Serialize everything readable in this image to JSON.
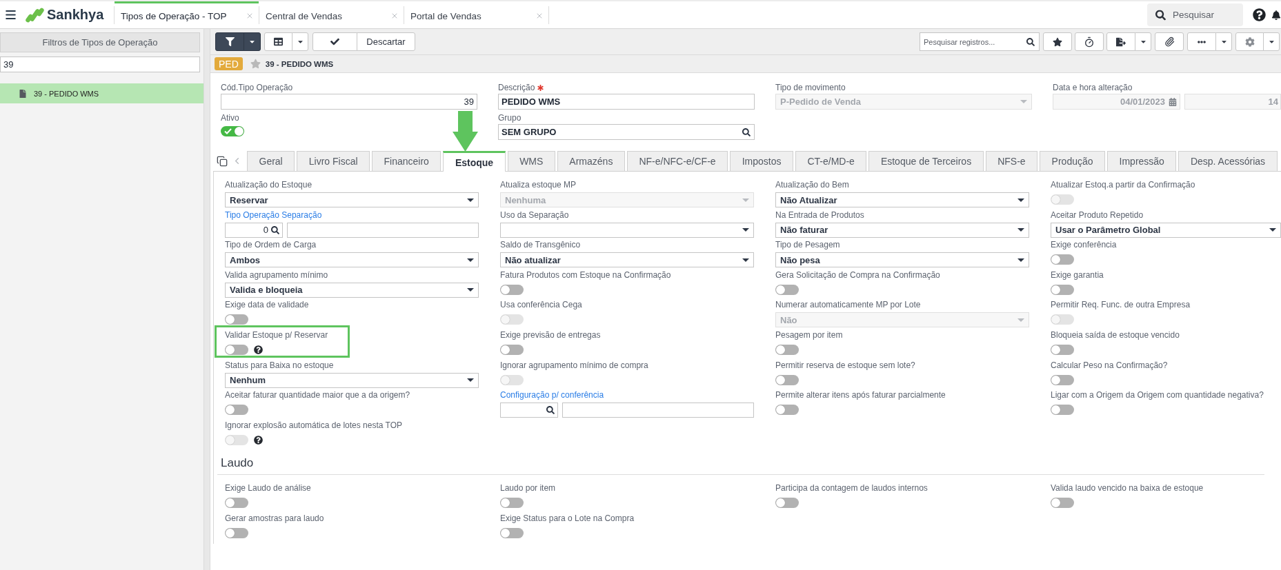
{
  "top_bar": {
    "logo": "Sankhya",
    "tabs": [
      {
        "label": "Tipos de Operação - TOP",
        "selected": true
      },
      {
        "label": "Central de Vendas",
        "selected": false
      },
      {
        "label": "Portal de Vendas",
        "selected": false
      }
    ],
    "search": {
      "placeholder": "Pesquisar"
    }
  },
  "sidebar": {
    "title": "Filtros de Tipos de Operação",
    "filter": {
      "value": "39"
    },
    "items": [
      {
        "label": "39 - PEDIDO WMS",
        "selected": true
      }
    ]
  },
  "toolbar": {
    "discard": "Descartar",
    "search": {
      "placeholder": "Pesquisar registros..."
    }
  },
  "record": {
    "badge": "PED",
    "favorite": false,
    "title": "39 - PEDIDO WMS"
  },
  "header": {
    "rows": [
      [
        {
          "label": "Cód.Tipo Operação",
          "kind": "number",
          "value": "39",
          "required": false
        },
        {
          "label": "Descrição",
          "kind": "text",
          "value": "PEDIDO WMS",
          "required": true
        },
        {
          "label": "Tipo de movimento",
          "kind": "select",
          "value": "P-Pedido de Venda",
          "disabled": true,
          "required": false
        },
        {
          "label": "Data e hora alteração",
          "kind": "datetime",
          "date": "04/01/2023",
          "time": "14",
          "disabled": true,
          "required": false
        }
      ],
      [
        {
          "label": "Ativo",
          "kind": "toggle",
          "on": true,
          "disabled": false,
          "required": false
        },
        {
          "label": "Grupo",
          "kind": "search",
          "value": "SEM GRUPO",
          "required": false
        }
      ]
    ]
  },
  "tabs": [
    {
      "label": "Geral",
      "selected": false,
      "pointer_arrow": false
    },
    {
      "label": "Livro Fiscal",
      "selected": false,
      "pointer_arrow": false
    },
    {
      "label": "Financeiro",
      "selected": false,
      "pointer_arrow": false
    },
    {
      "label": "Estoque",
      "selected": true,
      "pointer_arrow": true
    },
    {
      "label": "WMS",
      "selected": false,
      "pointer_arrow": false
    },
    {
      "label": "Armazéns",
      "selected": false,
      "pointer_arrow": false
    },
    {
      "label": "NF-e/NFC-e/CF-e",
      "selected": false,
      "pointer_arrow": false
    },
    {
      "label": "Impostos",
      "selected": false,
      "pointer_arrow": false
    },
    {
      "label": "CT-e/MD-e",
      "selected": false,
      "pointer_arrow": false
    },
    {
      "label": "Estoque de Terceiros",
      "selected": false,
      "pointer_arrow": false
    },
    {
      "label": "NFS-e",
      "selected": false,
      "pointer_arrow": false
    },
    {
      "label": "Produção",
      "selected": false,
      "pointer_arrow": false
    },
    {
      "label": "Impressão",
      "selected": false,
      "pointer_arrow": false
    },
    {
      "label": "Desp. Acessórias",
      "selected": false,
      "pointer_arrow": false
    }
  ],
  "tab_content": {
    "columns": [
      {
        "fields": [
          {
            "label": "Atualização do Estoque",
            "kind": "select",
            "value": "Reservar",
            "disabled": false,
            "highlighted": false
          },
          {
            "label": "Tipo Operação Separação",
            "kind": "lookup",
            "code": "0",
            "highlighted": false
          },
          {
            "label": "Tipo de Ordem de Carga",
            "kind": "select",
            "value": "Ambos",
            "disabled": false,
            "highlighted": false
          },
          {
            "label": "Valida agrupamento mínimo",
            "kind": "select",
            "value": "Valida e bloqueia",
            "disabled": false,
            "highlighted": false
          },
          {
            "label": "Exige data de validade",
            "kind": "toggle",
            "on": false,
            "disabled": false,
            "help": false,
            "highlighted": false
          },
          {
            "label": "Validar Estoque p/ Reservar",
            "kind": "toggle",
            "on": false,
            "disabled": false,
            "help": true,
            "highlighted": true
          },
          {
            "label": "Status para Baixa no estoque",
            "kind": "select",
            "value": "Nenhum",
            "disabled": false,
            "highlighted": false
          },
          {
            "label": "Aceitar faturar quantidade maior que a da origem?",
            "kind": "toggle",
            "on": false,
            "disabled": false,
            "help": false,
            "highlighted": false
          },
          {
            "label": "Ignorar explosão automática de lotes nesta TOP",
            "kind": "toggle",
            "on": false,
            "disabled": true,
            "help": true,
            "highlighted": false
          }
        ]
      },
      {
        "fields": [
          {
            "label": "Atualiza estoque MP",
            "kind": "select",
            "value": "Nenhuma",
            "disabled": true,
            "highlighted": false
          },
          {
            "label": "Uso da Separação",
            "kind": "select",
            "disabled": false,
            "highlighted": false
          },
          {
            "label": "Saldo de Transgênico",
            "kind": "select",
            "value": "Não atualizar",
            "disabled": false,
            "highlighted": false
          },
          {
            "label": "Fatura Produtos com Estoque na Confirmação",
            "kind": "toggle",
            "on": false,
            "disabled": false,
            "help": false,
            "highlighted": false
          },
          {
            "label": "Usa conferência Cega",
            "kind": "toggle",
            "on": false,
            "disabled": true,
            "help": false,
            "highlighted": false
          },
          {
            "label": "Exige previsão de entregas",
            "kind": "toggle",
            "on": false,
            "disabled": false,
            "help": false,
            "highlighted": false
          },
          {
            "label": "Ignorar agrupamento mínimo de compra",
            "kind": "toggle",
            "on": false,
            "disabled": true,
            "help": false,
            "highlighted": false
          },
          {
            "label": "Configuração p/ conferência",
            "kind": "lookup",
            "highlighted": false
          }
        ]
      },
      {
        "fields": [
          {
            "label": "Atualização do Bem",
            "kind": "select",
            "value": "Não Atualizar",
            "disabled": false,
            "highlighted": false
          },
          {
            "label": "Na Entrada de Produtos",
            "kind": "select",
            "value": "Não faturar",
            "disabled": false,
            "highlighted": false
          },
          {
            "label": "Tipo de Pesagem",
            "kind": "select",
            "value": "Não pesa",
            "disabled": false,
            "highlighted": false
          },
          {
            "label": "Gera Solicitação de Compra na Confirmação",
            "kind": "toggle",
            "on": false,
            "disabled": false,
            "help": false,
            "highlighted": false
          },
          {
            "label": "Numerar automaticamente MP por Lote",
            "kind": "select",
            "value": "Não",
            "disabled": true,
            "highlighted": false
          },
          {
            "label": "Pesagem por item",
            "kind": "toggle",
            "on": false,
            "disabled": false,
            "help": false,
            "highlighted": false
          },
          {
            "label": "Permitir reserva de estoque sem lote?",
            "kind": "toggle",
            "on": false,
            "disabled": false,
            "help": false,
            "highlighted": false
          },
          {
            "label": "Permite alterar itens após faturar parcialmente",
            "kind": "toggle",
            "on": false,
            "disabled": false,
            "help": false,
            "highlighted": false
          }
        ]
      },
      {
        "fields": [
          {
            "label": "Atualizar Estoq.a partir da Confirmação",
            "kind": "toggle",
            "on": false,
            "disabled": true,
            "help": false,
            "highlighted": false
          },
          {
            "label": "Aceitar Produto Repetido",
            "kind": "select",
            "value": "Usar o Parâmetro Global",
            "disabled": false,
            "highlighted": false
          },
          {
            "label": "Exige conferência",
            "kind": "toggle",
            "on": false,
            "disabled": false,
            "help": false,
            "highlighted": false
          },
          {
            "label": "Exige garantia",
            "kind": "toggle",
            "on": false,
            "disabled": false,
            "help": false,
            "highlighted": false
          },
          {
            "label": "Permitir Req. Func. de outra Empresa",
            "kind": "toggle",
            "on": false,
            "disabled": true,
            "help": false,
            "highlighted": false
          },
          {
            "label": "Bloqueia saída de estoque vencido",
            "kind": "toggle",
            "on": false,
            "disabled": false,
            "help": false,
            "highlighted": false
          },
          {
            "label": "Calcular Peso na Confirmação?",
            "kind": "toggle",
            "on": false,
            "disabled": false,
            "help": false,
            "highlighted": false
          },
          {
            "label": "Ligar com a Origem da Origem com quantidade negativa?",
            "kind": "toggle",
            "on": false,
            "disabled": false,
            "help": false,
            "highlighted": false
          }
        ]
      }
    ]
  },
  "laudo": {
    "title": "Laudo",
    "columns": [
      {
        "fields": [
          {
            "label": "Exige Laudo de análise",
            "kind": "toggle",
            "on": false,
            "disabled": false,
            "help": false,
            "highlighted": false
          },
          {
            "label": "Gerar amostras para laudo",
            "kind": "toggle",
            "on": false,
            "disabled": false,
            "help": false,
            "highlighted": false
          }
        ]
      },
      {
        "fields": [
          {
            "label": "Laudo por item",
            "kind": "toggle",
            "on": false,
            "disabled": false,
            "help": false,
            "highlighted": false
          },
          {
            "label": "Exige Status para o Lote na Compra",
            "kind": "toggle",
            "on": false,
            "disabled": false,
            "help": false,
            "highlighted": false
          }
        ]
      },
      {
        "fields": [
          {
            "label": "Participa da contagem de laudos internos",
            "kind": "toggle",
            "on": false,
            "disabled": false,
            "help": false,
            "highlighted": false
          }
        ]
      },
      {
        "fields": [
          {
            "label": "Valida laudo vencido na baixa de estoque",
            "kind": "toggle",
            "on": false,
            "disabled": false,
            "help": false,
            "highlighted": false
          }
        ]
      }
    ]
  }
}
